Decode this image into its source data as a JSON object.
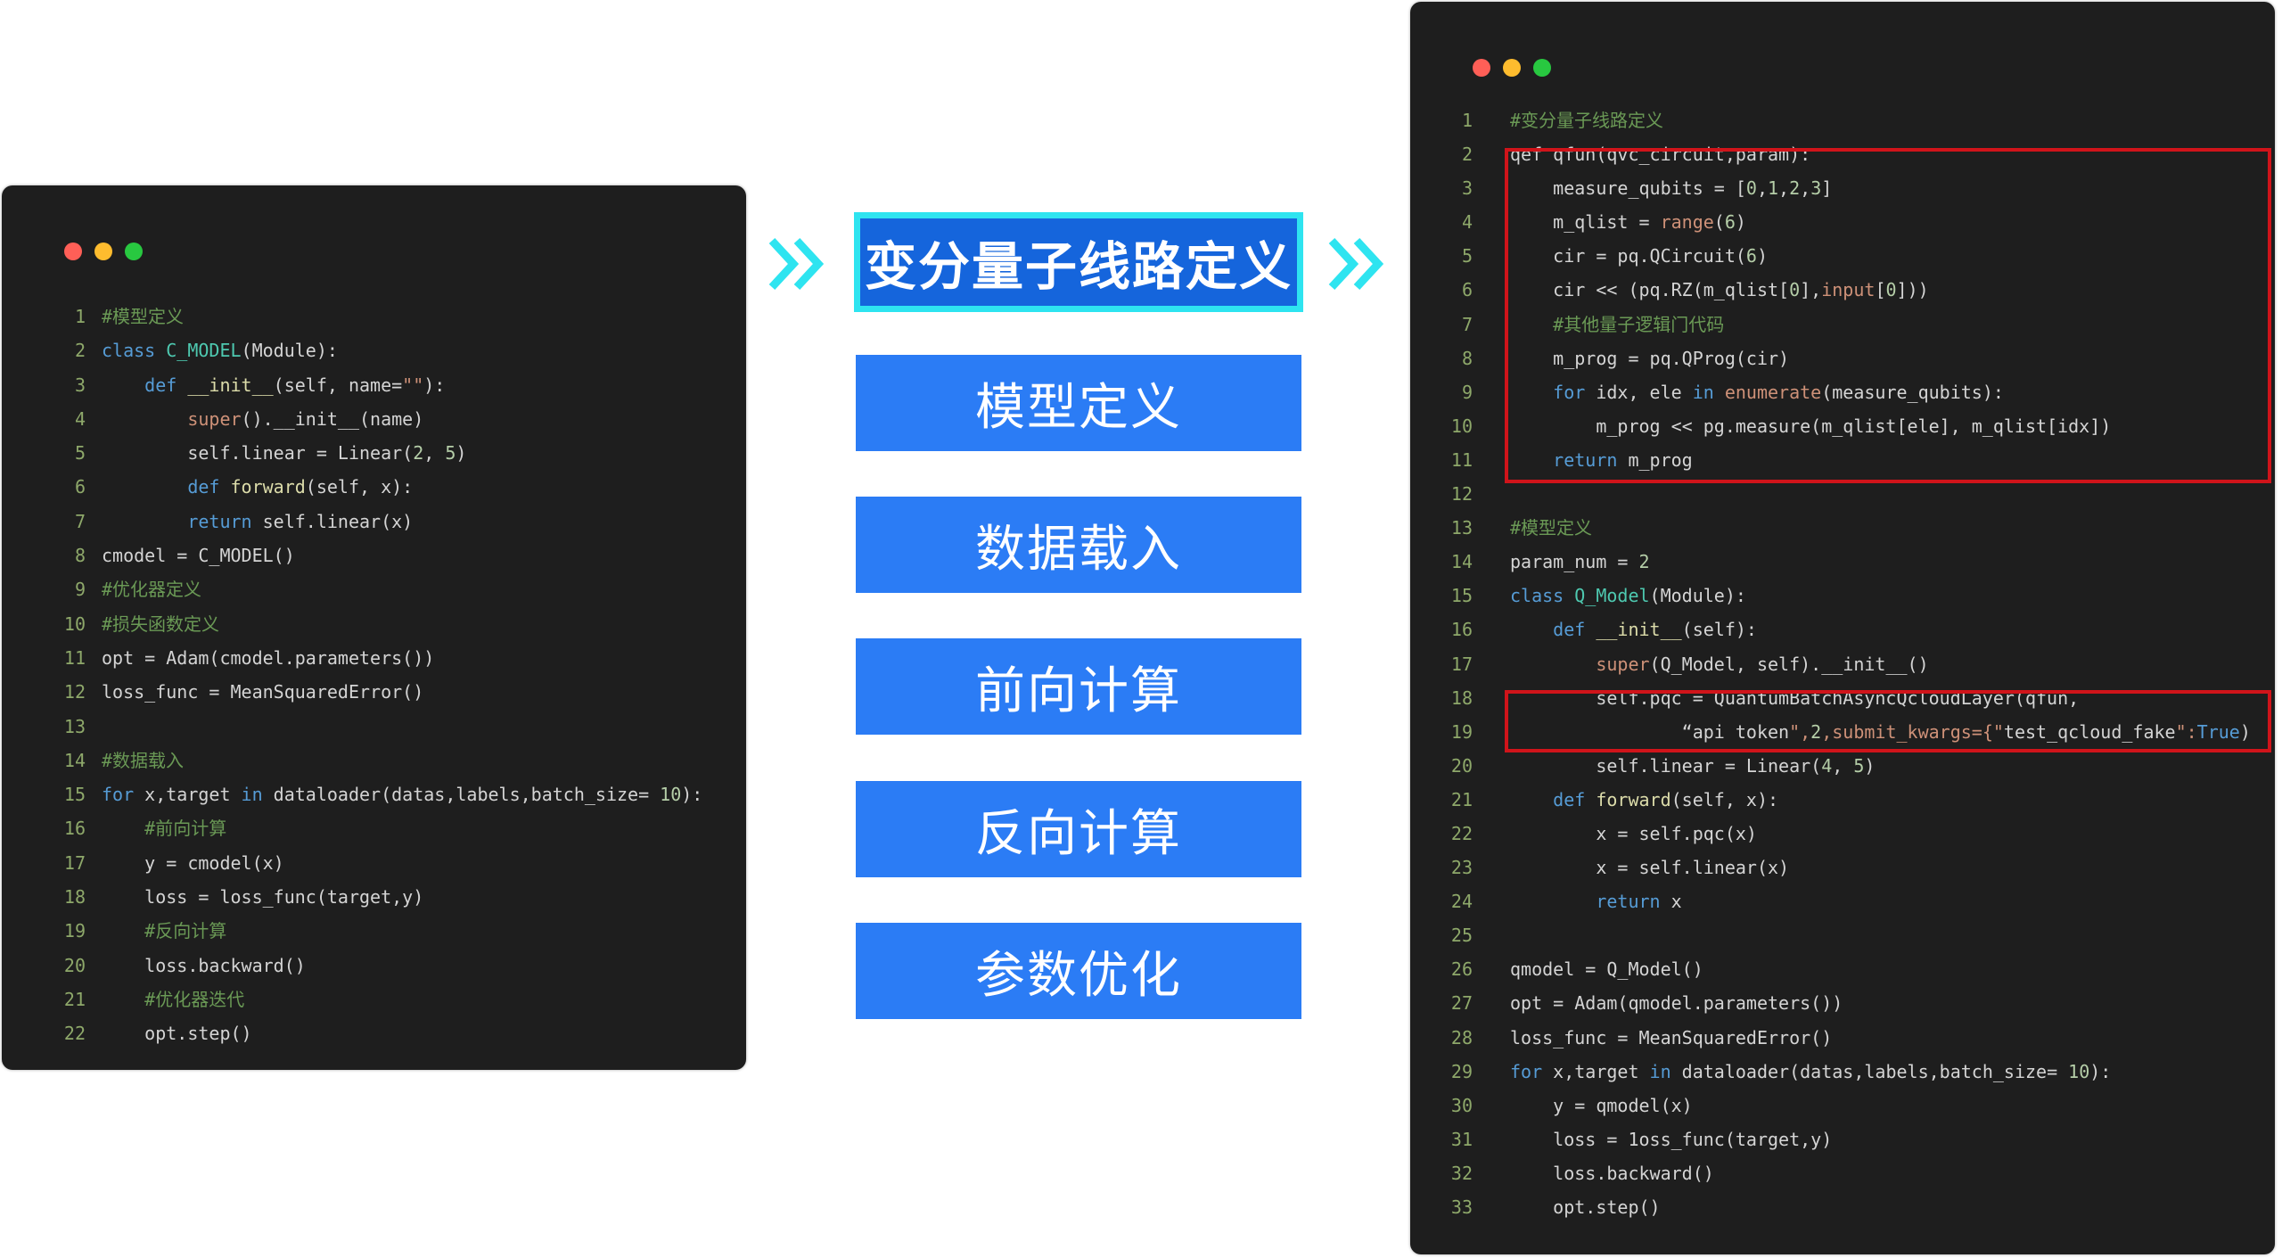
{
  "steps": [
    {
      "label": "变分量子线路定义",
      "active": true
    },
    {
      "label": "模型定义",
      "active": false
    },
    {
      "label": "数据载入",
      "active": false
    },
    {
      "label": "前向计算",
      "active": false
    },
    {
      "label": "反向计算",
      "active": false
    },
    {
      "label": "参数优化",
      "active": false
    }
  ],
  "left_code": [
    {
      "n": "1",
      "tokens": [
        [
          "c",
          "#模型定义"
        ]
      ]
    },
    {
      "n": "2",
      "tokens": [
        [
          "k",
          "class "
        ],
        [
          "t",
          "C_MODEL"
        ],
        [
          "p",
          "(Module):"
        ]
      ]
    },
    {
      "n": "3",
      "tokens": [
        [
          "p",
          "    "
        ],
        [
          "k",
          "def "
        ],
        [
          "f",
          "__init__"
        ],
        [
          "p",
          "(self, name="
        ],
        [
          "s",
          "\"\""
        ],
        [
          "p",
          "):"
        ]
      ]
    },
    {
      "n": "4",
      "tokens": [
        [
          "p",
          "        "
        ],
        [
          "b",
          "super"
        ],
        [
          "p",
          "().__init__(name)"
        ]
      ]
    },
    {
      "n": "5",
      "tokens": [
        [
          "p",
          "        self.linear = Linear("
        ],
        [
          "n",
          "2"
        ],
        [
          "p",
          ", "
        ],
        [
          "n",
          "5"
        ],
        [
          "p",
          ")"
        ]
      ]
    },
    {
      "n": "6",
      "tokens": [
        [
          "p",
          "        "
        ],
        [
          "k",
          "def "
        ],
        [
          "f",
          "forward"
        ],
        [
          "p",
          "(self, x):"
        ]
      ]
    },
    {
      "n": "7",
      "tokens": [
        [
          "p",
          "        "
        ],
        [
          "k",
          "return "
        ],
        [
          "p",
          "self.linear(x)"
        ]
      ]
    },
    {
      "n": "8",
      "tokens": [
        [
          "p",
          "cmodel = C_MODEL()"
        ]
      ]
    },
    {
      "n": "9",
      "tokens": [
        [
          "c",
          "#优化器定义"
        ]
      ]
    },
    {
      "n": "10",
      "tokens": [
        [
          "c",
          "#损失函数定义"
        ]
      ]
    },
    {
      "n": "11",
      "tokens": [
        [
          "p",
          "opt = Adam(cmodel.parameters())"
        ]
      ]
    },
    {
      "n": "12",
      "tokens": [
        [
          "p",
          "loss_func = MeanSquaredError()"
        ]
      ]
    },
    {
      "n": "13",
      "tokens": []
    },
    {
      "n": "14",
      "tokens": [
        [
          "c",
          "#数据载入"
        ]
      ]
    },
    {
      "n": "15",
      "tokens": [
        [
          "k",
          "for "
        ],
        [
          "p",
          "x,target "
        ],
        [
          "k",
          "in "
        ],
        [
          "p",
          "dataloader(datas,labels,batch_size= "
        ],
        [
          "n",
          "10"
        ],
        [
          "p",
          "):"
        ]
      ]
    },
    {
      "n": "16",
      "tokens": [
        [
          "p",
          "    "
        ],
        [
          "c",
          "#前向计算"
        ]
      ]
    },
    {
      "n": "17",
      "tokens": [
        [
          "p",
          "    y = cmodel(x)"
        ]
      ]
    },
    {
      "n": "18",
      "tokens": [
        [
          "p",
          "    loss = loss_func(target,y)"
        ]
      ]
    },
    {
      "n": "19",
      "tokens": [
        [
          "p",
          "    "
        ],
        [
          "c",
          "#反向计算"
        ]
      ]
    },
    {
      "n": "20",
      "tokens": [
        [
          "p",
          "    loss.backward()"
        ]
      ]
    },
    {
      "n": "21",
      "tokens": [
        [
          "p",
          "    "
        ],
        [
          "c",
          "#优化器迭代"
        ]
      ]
    },
    {
      "n": "22",
      "tokens": [
        [
          "p",
          "    opt.step()"
        ]
      ]
    }
  ],
  "right_code": [
    {
      "n": "1",
      "tokens": [
        [
          "c",
          "#变分量子线路定义"
        ]
      ]
    },
    {
      "n": "2",
      "tokens": [
        [
          "p",
          "qef qfun(qvc_circuit,param):"
        ]
      ]
    },
    {
      "n": "3",
      "tokens": [
        [
          "p",
          "    measure_qubits = ["
        ],
        [
          "n",
          "0"
        ],
        [
          "p",
          ","
        ],
        [
          "n",
          "1"
        ],
        [
          "p",
          ","
        ],
        [
          "n",
          "2"
        ],
        [
          "p",
          ","
        ],
        [
          "n",
          "3"
        ],
        [
          "p",
          "]"
        ]
      ]
    },
    {
      "n": "4",
      "tokens": [
        [
          "p",
          "    m_qlist = "
        ],
        [
          "b",
          "range"
        ],
        [
          "p",
          "("
        ],
        [
          "n",
          "6"
        ],
        [
          "p",
          ")"
        ]
      ]
    },
    {
      "n": "5",
      "tokens": [
        [
          "p",
          "    cir = pq.QCircuit("
        ],
        [
          "n",
          "6"
        ],
        [
          "p",
          ")"
        ]
      ]
    },
    {
      "n": "6",
      "tokens": [
        [
          "p",
          "    cir << (pq.RZ(m_qlist["
        ],
        [
          "n",
          "0"
        ],
        [
          "p",
          "],"
        ],
        [
          "b",
          "input"
        ],
        [
          "p",
          "["
        ],
        [
          "n",
          "0"
        ],
        [
          "p",
          "]))"
        ]
      ]
    },
    {
      "n": "7",
      "tokens": [
        [
          "p",
          "    "
        ],
        [
          "c",
          "#其他量子逻辑门代码"
        ]
      ]
    },
    {
      "n": "8",
      "tokens": [
        [
          "p",
          "    m_prog = pq.QProg(cir)"
        ]
      ]
    },
    {
      "n": "9",
      "tokens": [
        [
          "p",
          "    "
        ],
        [
          "k",
          "for "
        ],
        [
          "p",
          "idx, ele "
        ],
        [
          "k",
          "in "
        ],
        [
          "b",
          "enumerate"
        ],
        [
          "p",
          "(measure_qubits):"
        ]
      ]
    },
    {
      "n": "10",
      "tokens": [
        [
          "p",
          "        m_prog << pg.measure(m_qlist[ele], m_qlist[idx])"
        ]
      ]
    },
    {
      "n": "11",
      "tokens": [
        [
          "p",
          "    "
        ],
        [
          "k",
          "return "
        ],
        [
          "p",
          "m_prog"
        ]
      ]
    },
    {
      "n": "12",
      "tokens": []
    },
    {
      "n": "13",
      "tokens": [
        [
          "c",
          "#模型定义"
        ]
      ]
    },
    {
      "n": "14",
      "tokens": [
        [
          "p",
          "param_num = "
        ],
        [
          "n",
          "2"
        ]
      ]
    },
    {
      "n": "15",
      "tokens": [
        [
          "k",
          "class "
        ],
        [
          "t",
          "Q_Model"
        ],
        [
          "p",
          "(Module):"
        ]
      ]
    },
    {
      "n": "16",
      "tokens": [
        [
          "p",
          "    "
        ],
        [
          "k",
          "def "
        ],
        [
          "f",
          "__init__"
        ],
        [
          "p",
          "(self):"
        ]
      ]
    },
    {
      "n": "17",
      "tokens": [
        [
          "p",
          "        "
        ],
        [
          "b",
          "super"
        ],
        [
          "p",
          "(Q_Model, self).__init__()"
        ]
      ]
    },
    {
      "n": "18",
      "tokens": [
        [
          "p",
          "        self.pqc = QuantumBatchAsyncQcloudLayer(qfun,"
        ]
      ]
    },
    {
      "n": "19",
      "tokens": [
        [
          "p",
          "                “api token"
        ],
        [
          "s",
          "\","
        ],
        [
          "n",
          "2"
        ],
        [
          "s",
          ",submit_kwargs={\""
        ],
        [
          "p",
          "test_qcloud_fake"
        ],
        [
          "s",
          "\":"
        ],
        [
          "k",
          "True"
        ],
        [
          "p",
          ")"
        ]
      ]
    },
    {
      "n": "20",
      "tokens": [
        [
          "p",
          "        self.linear = Linear("
        ],
        [
          "n",
          "4"
        ],
        [
          "p",
          ", "
        ],
        [
          "n",
          "5"
        ],
        [
          "p",
          ")"
        ]
      ]
    },
    {
      "n": "21",
      "tokens": [
        [
          "p",
          "    "
        ],
        [
          "k",
          "def "
        ],
        [
          "f",
          "forward"
        ],
        [
          "p",
          "(self, x):"
        ]
      ]
    },
    {
      "n": "22",
      "tokens": [
        [
          "p",
          "        x = self.pqc(x)"
        ]
      ]
    },
    {
      "n": "23",
      "tokens": [
        [
          "p",
          "        x = self.linear(x)"
        ]
      ]
    },
    {
      "n": "24",
      "tokens": [
        [
          "p",
          "        "
        ],
        [
          "k",
          "return "
        ],
        [
          "p",
          "x"
        ]
      ]
    },
    {
      "n": "25",
      "tokens": []
    },
    {
      "n": "26",
      "tokens": [
        [
          "p",
          "qmodel = Q_Model()"
        ]
      ]
    },
    {
      "n": "27",
      "tokens": [
        [
          "p",
          "opt = Adam(qmodel.parameters())"
        ]
      ]
    },
    {
      "n": "28",
      "tokens": [
        [
          "p",
          "loss_func = MeanSquaredError()"
        ]
      ]
    },
    {
      "n": "29",
      "tokens": [
        [
          "k",
          "for "
        ],
        [
          "p",
          "x,target "
        ],
        [
          "k",
          "in "
        ],
        [
          "p",
          "dataloader(datas,labels,batch_size= "
        ],
        [
          "n",
          "10"
        ],
        [
          "p",
          "):"
        ]
      ]
    },
    {
      "n": "30",
      "tokens": [
        [
          "p",
          "    y = qmodel(x)"
        ]
      ]
    },
    {
      "n": "31",
      "tokens": [
        [
          "p",
          "    loss = 1oss_func(target,y)"
        ]
      ]
    },
    {
      "n": "32",
      "tokens": [
        [
          "p",
          "    loss.backward()"
        ]
      ]
    },
    {
      "n": "33",
      "tokens": [
        [
          "p",
          "    opt.step()"
        ]
      ]
    }
  ],
  "colors": {
    "editor_bg": "#1e1e1e",
    "step_bg": "#2b7cf5",
    "step_active_bg": "#1565dc",
    "step_active_border": "#2ee4f0",
    "arrow": "#2ee4f0",
    "highlight_border": "#d0141a"
  },
  "icons": [
    "window-close-dot",
    "window-minimize-dot",
    "window-maximize-dot",
    "double-chevron-right-icon"
  ]
}
